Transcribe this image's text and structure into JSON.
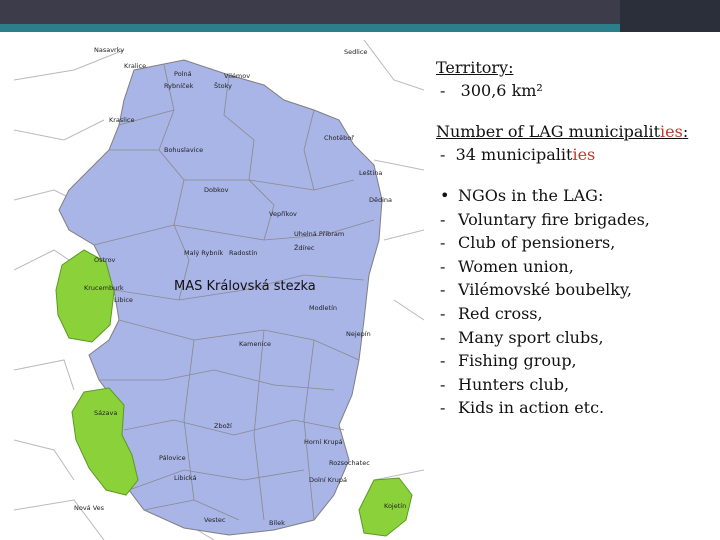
{
  "colors": {
    "region": "#a9b4e7",
    "green": "#8bd23a",
    "accent_teal": "#2b7f8a",
    "header_dark": "#3c3c4a",
    "red_suffix": "#c0392b"
  },
  "territory": {
    "heading": "Territory:",
    "dash": "-",
    "value": "300,6 km²"
  },
  "municipalities": {
    "heading_prefix": "Number of LAG municipalit",
    "heading_suffix": "ies",
    "heading_colon": ":",
    "dash": "-",
    "count_prefix": "34 municipalit",
    "count_suffix": "ies"
  },
  "ngos": {
    "items": [
      {
        "marker": "•",
        "text": "NGOs in the LAG:"
      },
      {
        "marker": "-",
        "text": "Voluntary fire brigades,"
      },
      {
        "marker": "-",
        "text": "Club of pensioners,"
      },
      {
        "marker": "-",
        "text": "Women union,"
      },
      {
        "marker": "-",
        "text": "Vilémovské boubelky,"
      },
      {
        "marker": "-",
        "text": "Red cross,"
      },
      {
        "marker": "-",
        "text": "Many sport clubs,"
      },
      {
        "marker": "-",
        "text": "Fishing group,"
      },
      {
        "marker": "-",
        "text": "Hunters club,"
      },
      {
        "marker": "-",
        "text": "Kids in action  etc."
      }
    ]
  },
  "map": {
    "title": "MAS Královská stezka",
    "labels": [
      "Nasavrky",
      "Kralice",
      "Polná",
      "Vilémov",
      "Štoky",
      "Sedlice",
      "Rybníček",
      "Kraslice",
      "Bohuslavice",
      "Chotěboř",
      "Uhelná Příbram",
      "Leština",
      "Dědina",
      "Malý Rybník",
      "Radostín",
      "Libice",
      "Ostrov",
      "Kamenice",
      "Dolní Krupá",
      "Horní Krupá",
      "Zboží",
      "Rozsochatec",
      "Kojetín",
      "Ždírec",
      "Vepříkov",
      "Dobkov",
      "Krucemburk",
      "Modletín",
      "Nová Ves",
      "Vestec",
      "Pálovice",
      "Nejepín",
      "Sázava",
      "Bílek",
      "Libická"
    ]
  }
}
